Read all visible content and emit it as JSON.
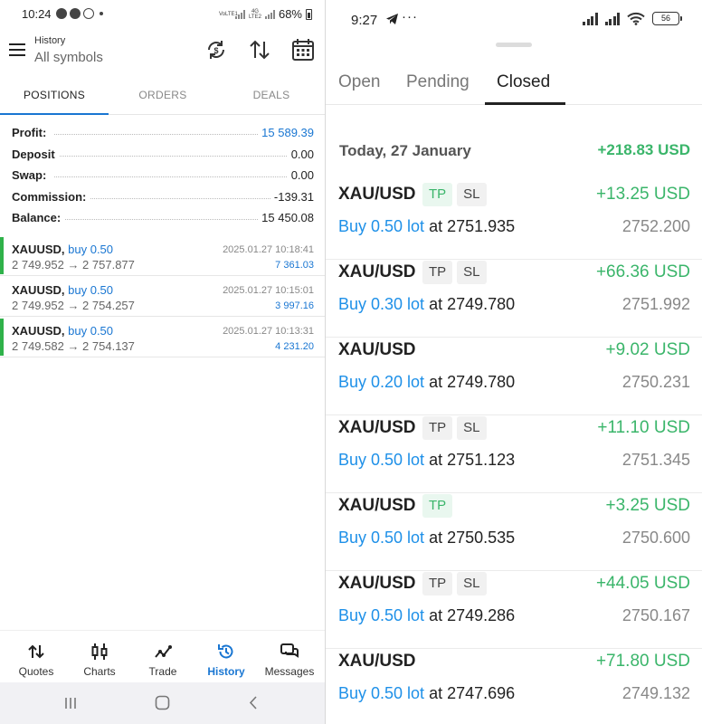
{
  "left": {
    "status": {
      "time": "10:24",
      "battery": "68%",
      "carrier1": "VoLTE1",
      "carrier2": "4G LTE2"
    },
    "app": {
      "title_small": "History",
      "title_big": "All symbols"
    },
    "tabs": [
      {
        "label": "POSITIONS"
      },
      {
        "label": "ORDERS"
      },
      {
        "label": "DEALS"
      }
    ],
    "summary": [
      {
        "label": "Profit:",
        "value": "15 589.39"
      },
      {
        "label": "Deposit",
        "value": "0.00"
      },
      {
        "label": "Swap:",
        "value": "0.00"
      },
      {
        "label": "Commission:",
        "value": "-139.31"
      },
      {
        "label": "Balance:",
        "value": "15 450.08"
      }
    ],
    "deals": [
      {
        "symbol": "XAUUSD,",
        "side": "buy 0.50",
        "prices": "2 749.952 → 2 757.877",
        "date": "2025.01.27 10:18:41",
        "profit": "7 361.03"
      },
      {
        "symbol": "XAUUSD,",
        "side": "buy 0.50",
        "prices": "2 749.952 → 2 754.257",
        "date": "2025.01.27 10:15:01",
        "profit": "3 997.16"
      },
      {
        "symbol": "XAUUSD,",
        "side": "buy 0.50",
        "prices": "2 749.582 → 2 754.137",
        "date": "2025.01.27 10:13:31",
        "profit": "4 231.20"
      }
    ],
    "nav": [
      {
        "label": "Quotes",
        "icon": "quotes-icon"
      },
      {
        "label": "Charts",
        "icon": "charts-icon"
      },
      {
        "label": "Trade",
        "icon": "trade-icon"
      },
      {
        "label": "History",
        "icon": "history-icon"
      },
      {
        "label": "Messages",
        "icon": "messages-icon"
      }
    ],
    "colors": {
      "accent": "#1976d2",
      "buy_bar": "#2fb24a"
    }
  },
  "right": {
    "status": {
      "time": "9:27",
      "more": "···",
      "battery": "56"
    },
    "tabs": [
      {
        "label": "Open"
      },
      {
        "label": "Pending"
      },
      {
        "label": "Closed"
      }
    ],
    "day": {
      "date": "Today, 27 January",
      "total": "+218.83 USD"
    },
    "trades": [
      {
        "symbol": "XAU/USD",
        "tp": "TP",
        "sl": "SL",
        "profit": "+13.25 USD",
        "lot": "Buy 0.50 lot",
        "at": " at 2751.935",
        "close": "2752.200"
      },
      {
        "symbol": "XAU/USD",
        "tp": "TP",
        "sl": "SL",
        "profit": "+66.36 USD",
        "lot": "Buy 0.30 lot",
        "at": " at 2749.780",
        "close": "2751.992"
      },
      {
        "symbol": "XAU/USD",
        "profit": "+9.02 USD",
        "lot": "Buy 0.20 lot",
        "at": " at 2749.780",
        "close": "2750.231"
      },
      {
        "symbol": "XAU/USD",
        "tp": "TP",
        "sl": "SL",
        "profit": "+11.10 USD",
        "lot": "Buy 0.50 lot",
        "at": " at 2751.123",
        "close": "2751.345"
      },
      {
        "symbol": "XAU/USD",
        "tp": "TP",
        "profit": "+3.25 USD",
        "lot": "Buy 0.50 lot",
        "at": " at 2750.535",
        "close": "2750.600"
      },
      {
        "symbol": "XAU/USD",
        "tp": "TP",
        "sl": "SL",
        "profit": "+44.05 USD",
        "lot": "Buy 0.50 lot",
        "at": " at 2749.286",
        "close": "2750.167"
      },
      {
        "symbol": "XAU/USD",
        "profit": "+71.80 USD",
        "lot": "Buy 0.50 lot",
        "at": " at 2747.696",
        "close": "2749.132"
      }
    ],
    "colors": {
      "profit": "#3ab56a",
      "link": "#1e90e8"
    }
  }
}
